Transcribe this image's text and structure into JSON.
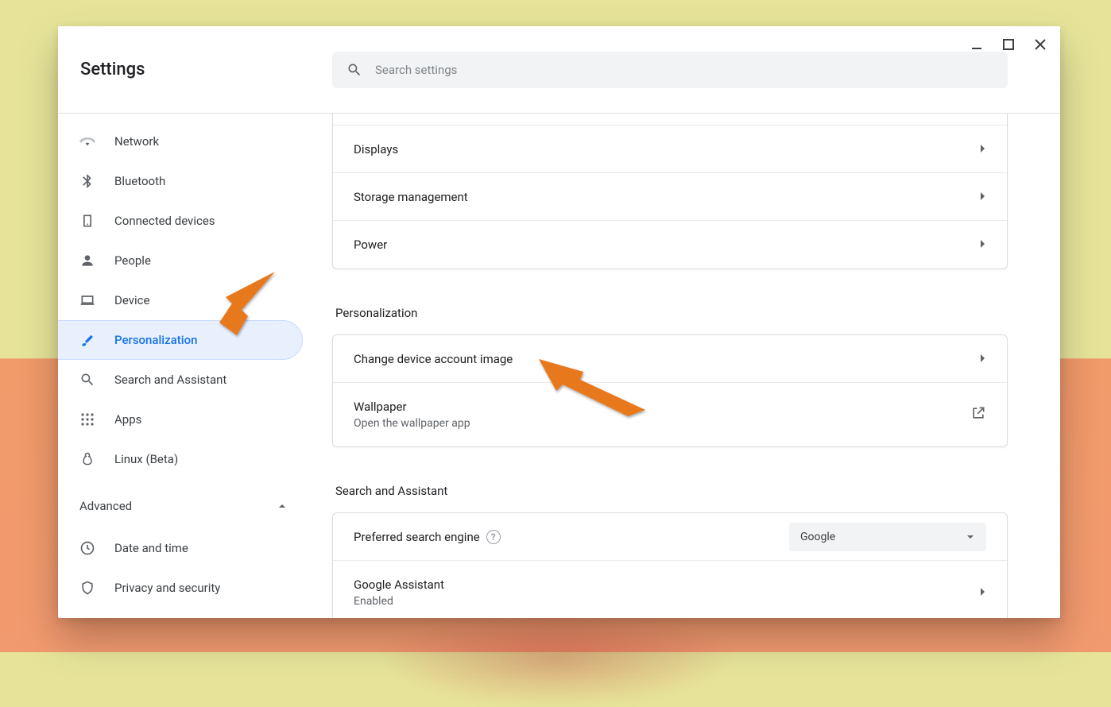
{
  "app": {
    "title": "Settings"
  },
  "search": {
    "placeholder": "Search settings"
  },
  "sidebar": {
    "items": [
      {
        "id": "network",
        "label": "Network",
        "icon": "wifi"
      },
      {
        "id": "bluetooth",
        "label": "Bluetooth",
        "icon": "bluetooth"
      },
      {
        "id": "connected",
        "label": "Connected devices",
        "icon": "devices"
      },
      {
        "id": "people",
        "label": "People",
        "icon": "person"
      },
      {
        "id": "device",
        "label": "Device",
        "icon": "laptop"
      },
      {
        "id": "personalization",
        "label": "Personalization",
        "icon": "brush",
        "selected": true
      },
      {
        "id": "search-assistant",
        "label": "Search and Assistant",
        "icon": "search"
      },
      {
        "id": "apps",
        "label": "Apps",
        "icon": "grid"
      },
      {
        "id": "linux",
        "label": "Linux (Beta)",
        "icon": "penguin"
      }
    ],
    "advanced": {
      "label": "Advanced",
      "expanded": true
    },
    "advanced_items": [
      {
        "id": "date-time",
        "label": "Date and time",
        "icon": "clock"
      },
      {
        "id": "privacy-security",
        "label": "Privacy and security",
        "icon": "shield"
      }
    ]
  },
  "sections": {
    "device_rows": [
      {
        "id": "displays",
        "label": "Displays"
      },
      {
        "id": "storage",
        "label": "Storage management"
      },
      {
        "id": "power",
        "label": "Power"
      }
    ],
    "personalization": {
      "title": "Personalization",
      "rows": [
        {
          "id": "change-image",
          "label": "Change device account image"
        },
        {
          "id": "wallpaper",
          "label": "Wallpaper",
          "sub": "Open the wallpaper app",
          "open_external": true
        }
      ]
    },
    "search_assistant": {
      "title": "Search and Assistant",
      "preferred_engine": {
        "label": "Preferred search engine",
        "value": "Google"
      },
      "assistant": {
        "label": "Google Assistant",
        "sub": "Enabled"
      }
    }
  }
}
